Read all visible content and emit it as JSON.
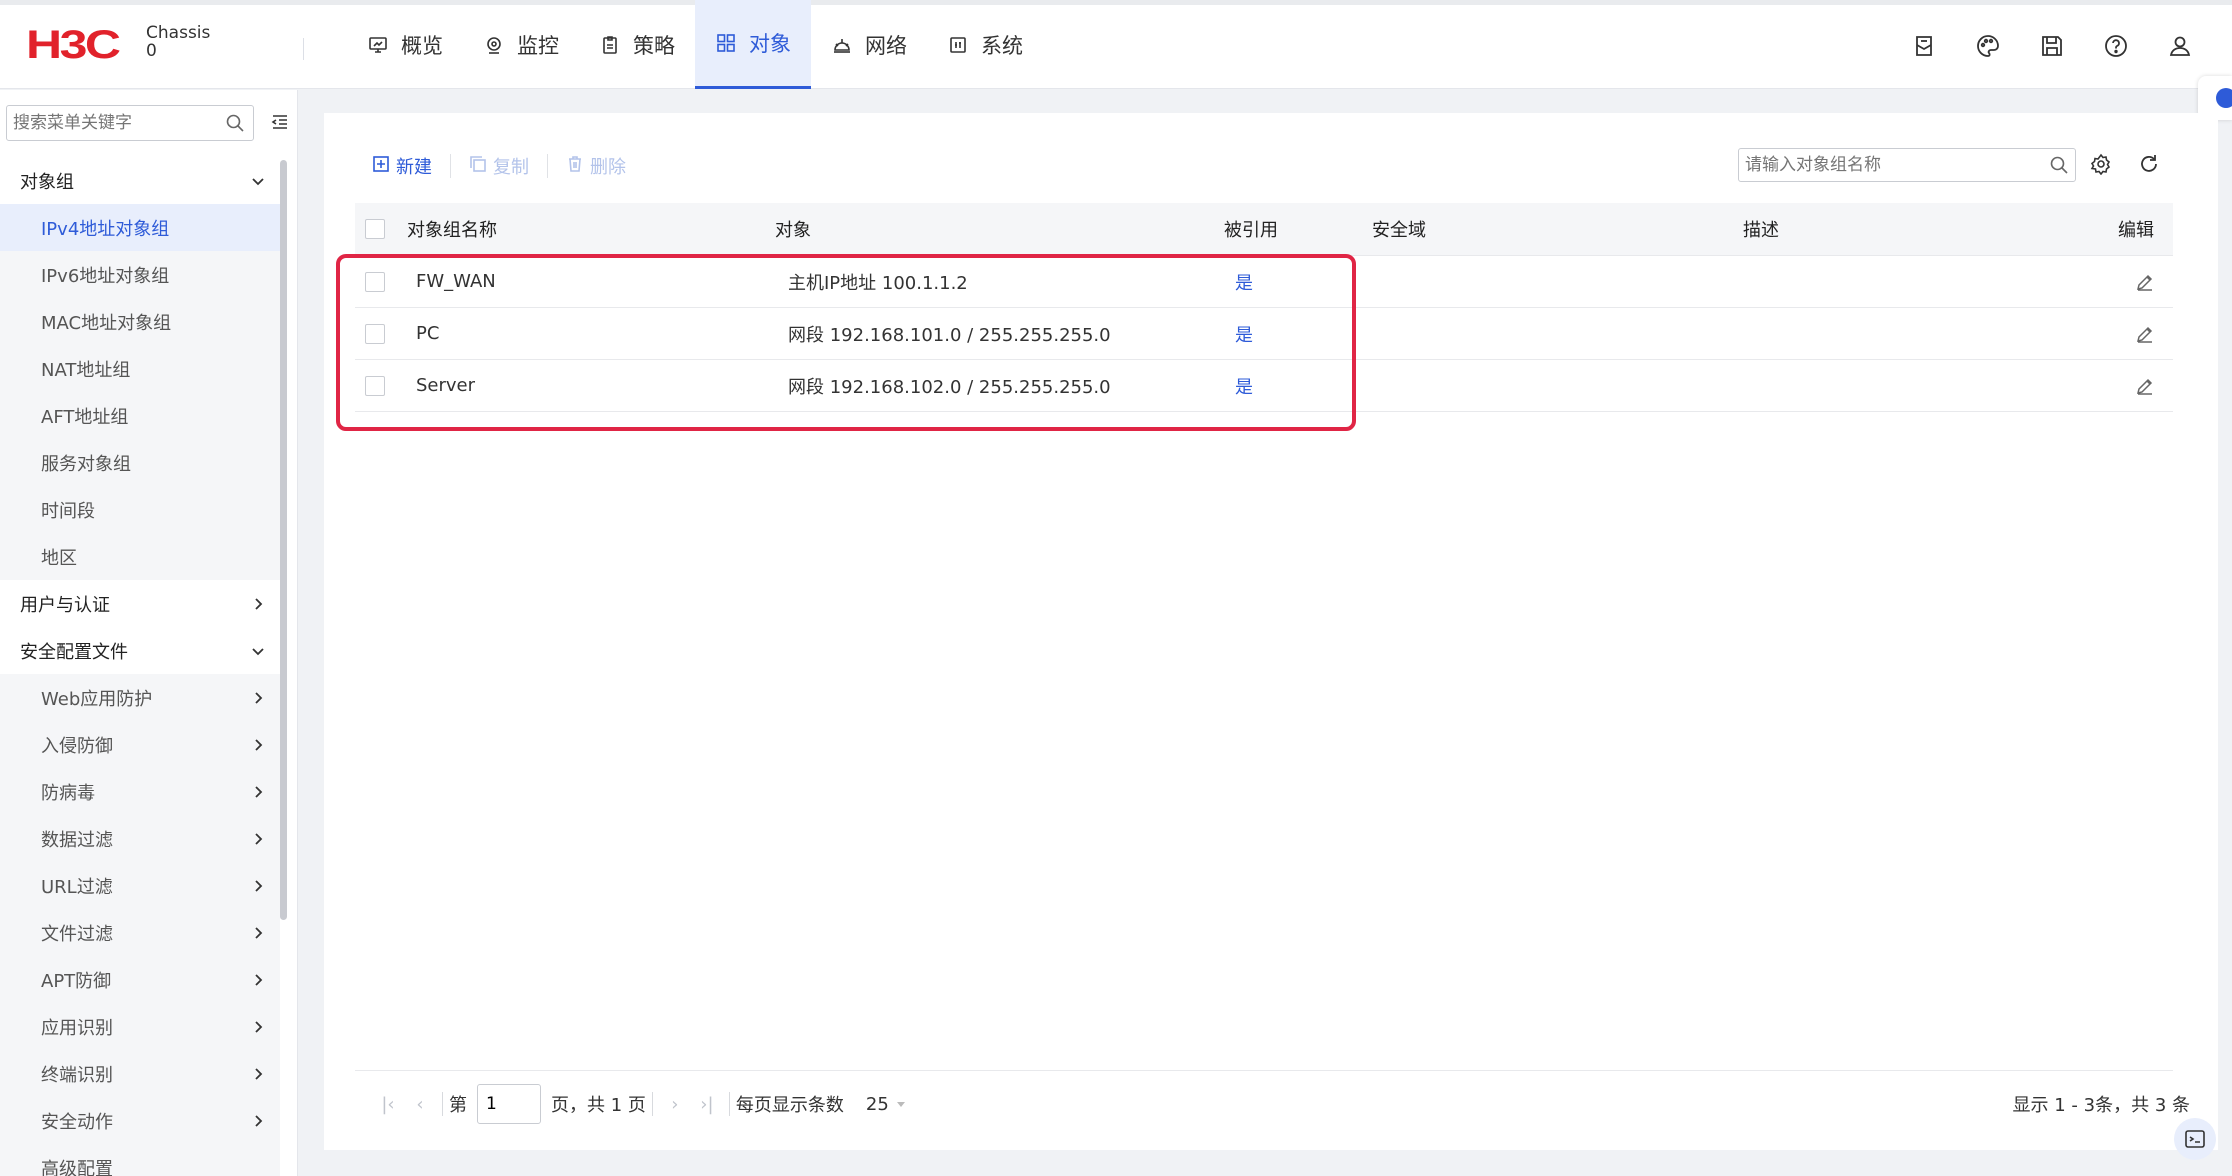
{
  "header": {
    "logo": "H3C",
    "device_label": "Chassis",
    "device_index": "0",
    "nav": [
      {
        "label": "概览",
        "icon": "dashboard-icon"
      },
      {
        "label": "监控",
        "icon": "monitor-icon"
      },
      {
        "label": "策略",
        "icon": "policy-icon"
      },
      {
        "label": "对象",
        "icon": "object-icon",
        "active": true
      },
      {
        "label": "网络",
        "icon": "network-icon"
      },
      {
        "label": "系统",
        "icon": "system-icon"
      }
    ],
    "tools": [
      "mailbox-icon",
      "palette-icon",
      "save-icon",
      "help-icon",
      "user-icon"
    ]
  },
  "sidebar": {
    "search_placeholder": "搜索菜单关键字",
    "groups": [
      {
        "label": "对象组",
        "expanded": true
      },
      {
        "label": "用户与认证",
        "expanded": false
      },
      {
        "label": "安全配置文件",
        "expanded": true
      }
    ],
    "object_items": [
      "IPv4地址对象组",
      "IPv6地址对象组",
      "MAC地址对象组",
      "NAT地址组",
      "AFT地址组",
      "服务对象组",
      "时间段",
      "地区"
    ],
    "security_items": [
      "Web应用防护",
      "入侵防御",
      "防病毒",
      "数据过滤",
      "URL过滤",
      "文件过滤",
      "APT防御",
      "应用识别",
      "终端识别",
      "安全动作",
      "高级配置"
    ]
  },
  "toolbar": {
    "new_label": "新建",
    "copy_label": "复制",
    "delete_label": "删除",
    "search_placeholder": "请输入对象组名称"
  },
  "table": {
    "columns": [
      "对象组名称",
      "对象",
      "被引用",
      "安全域",
      "描述",
      "编辑"
    ],
    "rows": [
      {
        "name": "FW_WAN",
        "object": "主机IP地址 100.1.1.2",
        "referenced": "是",
        "zone": "",
        "desc": ""
      },
      {
        "name": "PC",
        "object": "网段 192.168.101.0 / 255.255.255.0",
        "referenced": "是",
        "zone": "",
        "desc": ""
      },
      {
        "name": "Server",
        "object": "网段 192.168.102.0 / 255.255.255.0",
        "referenced": "是",
        "zone": "",
        "desc": ""
      }
    ]
  },
  "pager": {
    "page_prefix": "第",
    "page_value": "1",
    "page_suffix": "页，共 1 页",
    "page_size_label": "每页显示条数",
    "page_size": "25",
    "summary": "显示 1 - 3条，共 3 条"
  },
  "colors": {
    "accent": "#2e5bd8",
    "brand": "#e1222b",
    "highlight": "#e02545"
  }
}
